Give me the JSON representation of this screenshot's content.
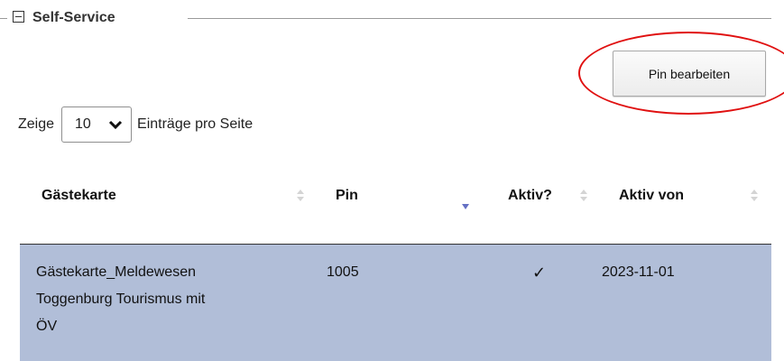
{
  "fieldset": {
    "title": "Self-Service"
  },
  "toolbar": {
    "edit_pin_label": "Pin bearbeiten"
  },
  "length": {
    "prefix": "Zeige",
    "selected": "10",
    "suffix": "Einträge pro Seite"
  },
  "table": {
    "columns": [
      "Gästekarte",
      "Pin",
      "Aktiv?",
      "Aktiv von"
    ],
    "sorted_column": "Pin",
    "sort_direction": "descending",
    "rows": [
      {
        "card_line1": "Gästekarte_Meldewesen",
        "card_line2": "Toggenburg Tourismus mit",
        "card_line3": "ÖV",
        "pin": "1005",
        "active": "✓",
        "active_from": "2023-11-01",
        "selected": true
      }
    ]
  },
  "colors": {
    "selected_row": "#b1bed8",
    "annotation": "#e01010",
    "sort_active": "#6470c4"
  }
}
